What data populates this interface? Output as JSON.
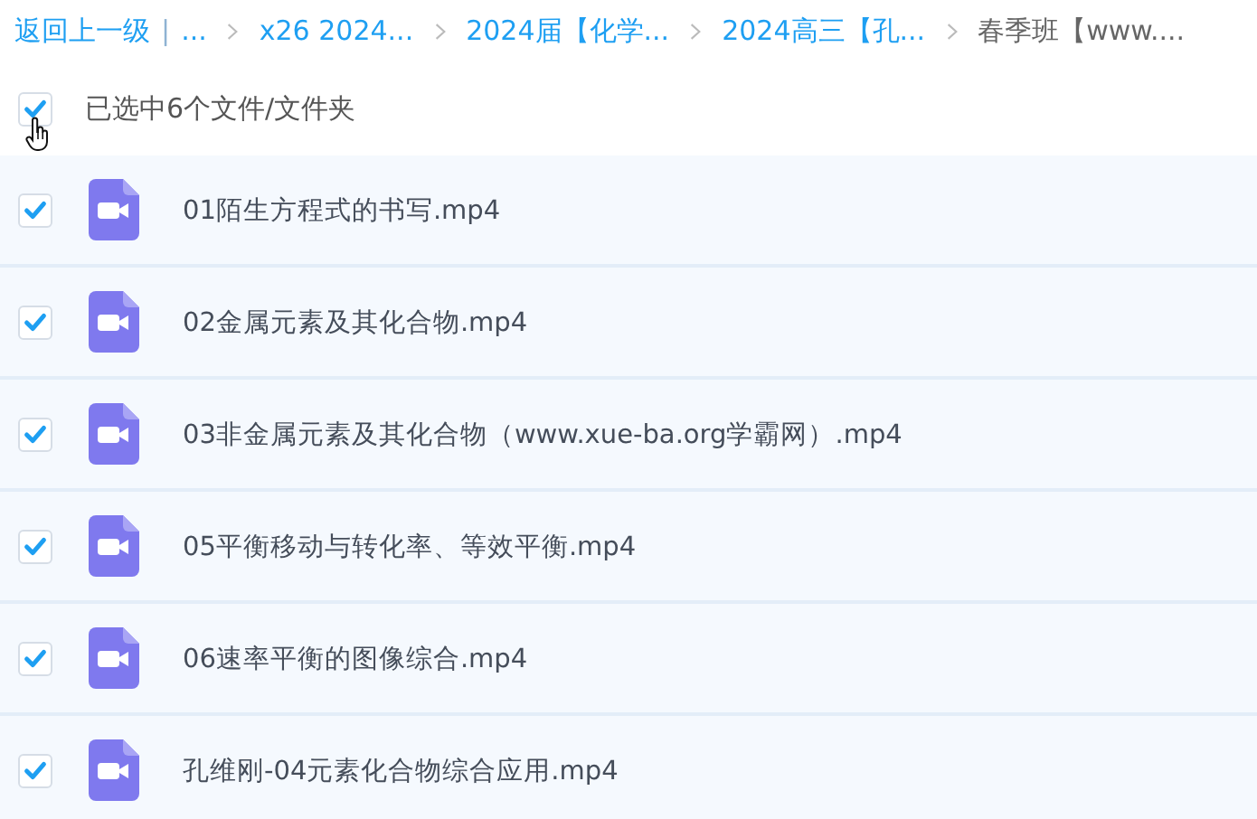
{
  "breadcrumb": {
    "back": "返回上一级",
    "separator": "|",
    "items": [
      {
        "label": "...",
        "current": false
      },
      {
        "label": "x26 2024...",
        "current": false
      },
      {
        "label": "2024届【化学...",
        "current": false
      },
      {
        "label": "2024高三【孔...",
        "current": false
      },
      {
        "label": "春季班【www....",
        "current": true
      }
    ]
  },
  "selection": {
    "checked": true,
    "label": "已选中6个文件/文件夹"
  },
  "files": [
    {
      "name": "01陌生方程式的书写.mp4",
      "checked": true
    },
    {
      "name": "02金属元素及其化合物.mp4",
      "checked": true
    },
    {
      "name": "03非金属元素及其化合物（www.xue-ba.org学霸网）.mp4",
      "checked": true
    },
    {
      "name": "05平衡移动与转化率、等效平衡.mp4",
      "checked": true
    },
    {
      "name": "06速率平衡的图像综合.mp4",
      "checked": true
    },
    {
      "name": "孔维刚-04元素化合物综合应用.mp4",
      "checked": true
    }
  ]
}
